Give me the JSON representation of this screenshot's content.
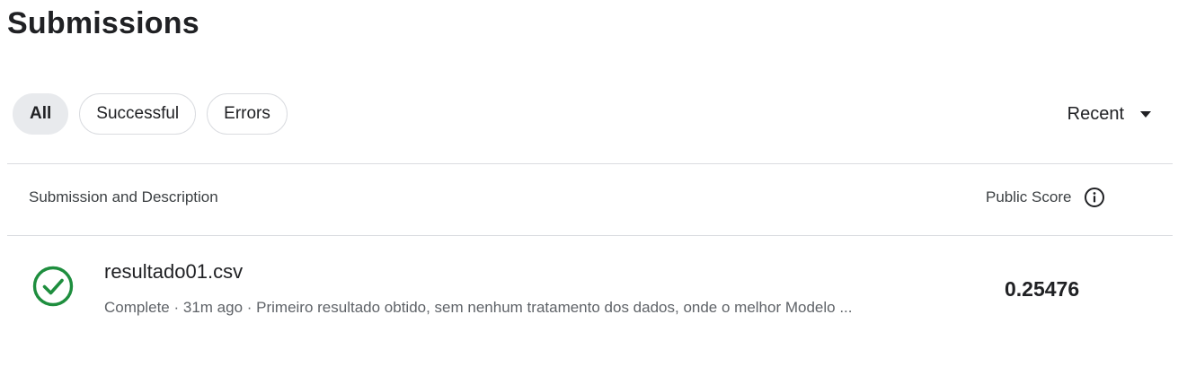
{
  "page": {
    "title": "Submissions"
  },
  "filters": {
    "all_label": "All",
    "successful_label": "Successful",
    "errors_label": "Errors",
    "active": "All"
  },
  "sort": {
    "selected": "Recent",
    "icon": "caret-down-icon"
  },
  "table": {
    "columns": {
      "left": "Submission and Description",
      "right": "Public Score",
      "right_icon": "info-icon"
    },
    "rows": [
      {
        "status_icon": "check-circle-icon",
        "status_color": "#1e8e3e",
        "file_name": "resultado01.csv",
        "meta": "Complete · 31m ago · Primeiro resultado obtido, sem nenhum tratamento dos dados, onde o melhor Modelo ...",
        "public_score": "0.25476"
      }
    ]
  }
}
